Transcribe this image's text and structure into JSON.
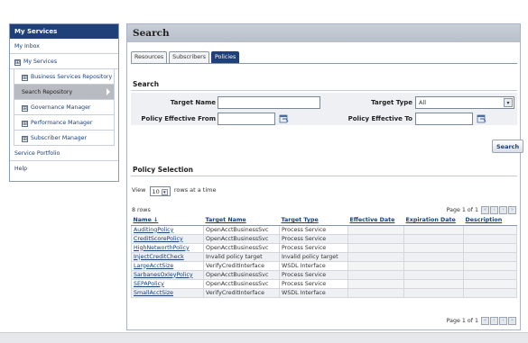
{
  "sidebar": {
    "title": "My Services",
    "items": [
      {
        "label": "My Inbox"
      },
      {
        "label": "My Services",
        "expander": "⊞"
      },
      {
        "label": "Business Services Repository",
        "expander": "⊞"
      },
      {
        "label": "Search Repository"
      },
      {
        "label": "Governance Manager",
        "expander": "⊞"
      },
      {
        "label": "Performance Manager",
        "expander": "⊞"
      },
      {
        "label": "Subscriber Manager",
        "expander": "⊞"
      },
      {
        "label": "Service Portfolio"
      },
      {
        "label": "Help"
      }
    ]
  },
  "main": {
    "title": "Search",
    "tabs": [
      {
        "label": "Resources"
      },
      {
        "label": "Subscribers"
      },
      {
        "label": "Policies"
      }
    ],
    "search_section": {
      "title": "Search",
      "target_name_label": "Target Name",
      "target_name_value": "",
      "target_type_label": "Target Type",
      "target_type_value": "All",
      "policy_from_label": "Policy Effective From",
      "policy_from_value": "",
      "policy_to_label": "Policy Effective To",
      "policy_to_value": "",
      "search_button": "Search"
    },
    "selection_section": {
      "title": "Policy Selection",
      "view_prefix": "View",
      "view_value": "10",
      "view_suffix": "rows at a time",
      "rows_count": "8 rows",
      "pager_top": "Page 1 of 1",
      "pager_bottom": "Page 1 of 1"
    },
    "table": {
      "columns": [
        "Name ↓",
        "Target Name",
        "Target Type",
        "Effective Date",
        "Expiration Date",
        "Description"
      ],
      "rows": [
        [
          "AuditingPolicy",
          "OpenAcctBusinessSvc",
          "Process Service",
          "",
          "",
          ""
        ],
        [
          "CreditScorePolicy",
          "OpenAcctBusinessSvc",
          "Process Service",
          "",
          "",
          ""
        ],
        [
          "HighNetworthPolicy",
          "OpenAcctBusinessSvc",
          "Process Service",
          "",
          "",
          ""
        ],
        [
          "InjectCreditCheck",
          "Invalid policy target",
          "Invalid policy target",
          "",
          "",
          ""
        ],
        [
          "LargeAcctSize",
          "VerifyCreditInterface",
          "WSDL Interface",
          "",
          "",
          ""
        ],
        [
          "SarbanesOxleyPolicy",
          "OpenAcctBusinessSvc",
          "Process Service",
          "",
          "",
          ""
        ],
        [
          "SEPAPolicy",
          "OpenAcctBusinessSvc",
          "Process Service",
          "",
          "",
          ""
        ],
        [
          "SmallAcctSize",
          "VerifyCreditInterface",
          "WSDL Interface",
          "",
          "",
          ""
        ]
      ]
    }
  },
  "colors": {
    "accent": "#20407a",
    "link": "#1a3f7a",
    "header_bg": "#c9cfd8"
  }
}
